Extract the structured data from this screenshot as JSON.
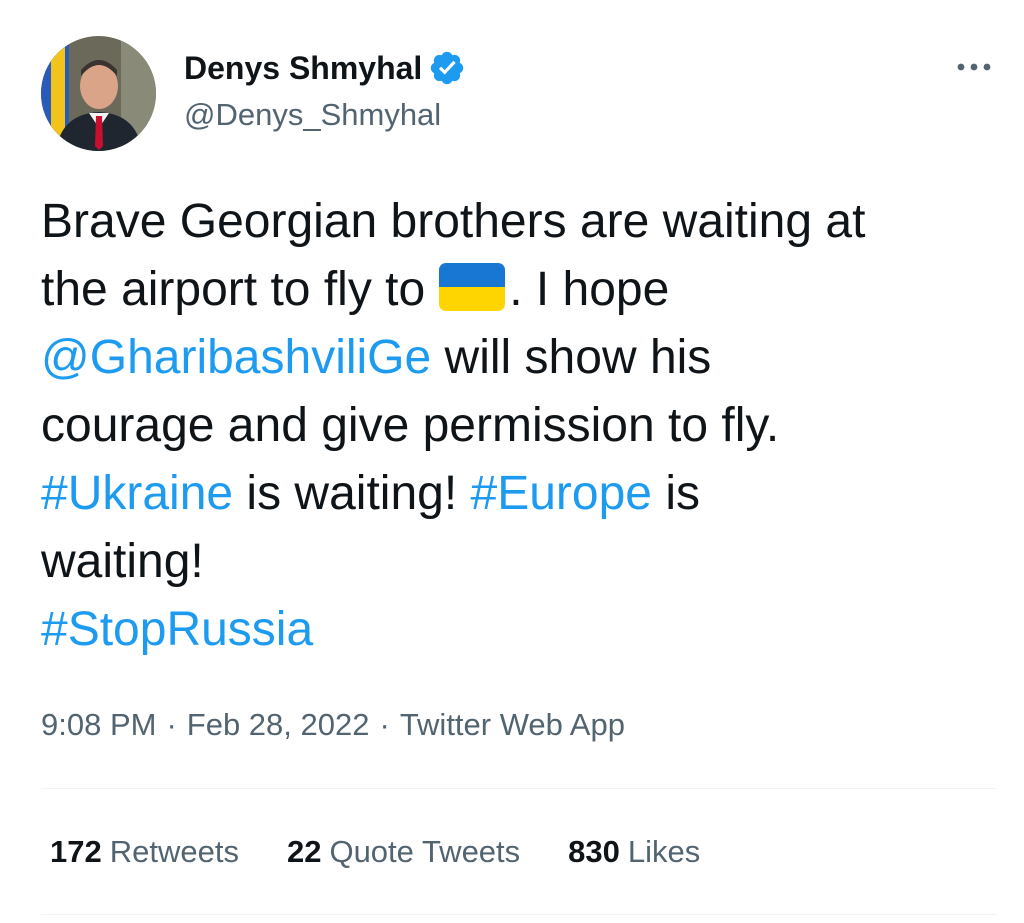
{
  "author": {
    "display_name": "Denys Shmyhal",
    "handle": "@Denys_Shmyhal",
    "verified_icon": "verified-badge-icon",
    "avatar_icon": "profile-photo"
  },
  "more_icon": "more-horizontal-icon",
  "tweet": {
    "line1": "Brave Georgian brothers are waiting at",
    "line2_prefix": "the airport to fly to",
    "flag_emoji": "ukraine-flag-emoji",
    "line2_suffix": ". I hope",
    "mention": "@GharibashviliGe",
    "line3_suffix": " will show his",
    "line4": "courage and give permission to fly.",
    "hashtag_ukraine": "#Ukraine",
    "line5_mid": " is waiting! ",
    "hashtag_europe": "#Europe",
    "line5_suffix": " is",
    "line6": "waiting!",
    "hashtag_stoprussia": "#StopRussia"
  },
  "meta": {
    "time": "9:08 PM",
    "separator": "·",
    "date": "Feb 28, 2022",
    "source": "Twitter Web App"
  },
  "stats": {
    "retweets_count": "172",
    "retweets_label": "Retweets",
    "quotes_count": "22",
    "quotes_label": "Quote Tweets",
    "likes_count": "830",
    "likes_label": "Likes"
  },
  "colors": {
    "link": "#1d9bf0",
    "text": "#0f1419",
    "secondary": "#536471",
    "flag_blue": "#1877d2",
    "flag_yellow": "#ffd500"
  }
}
